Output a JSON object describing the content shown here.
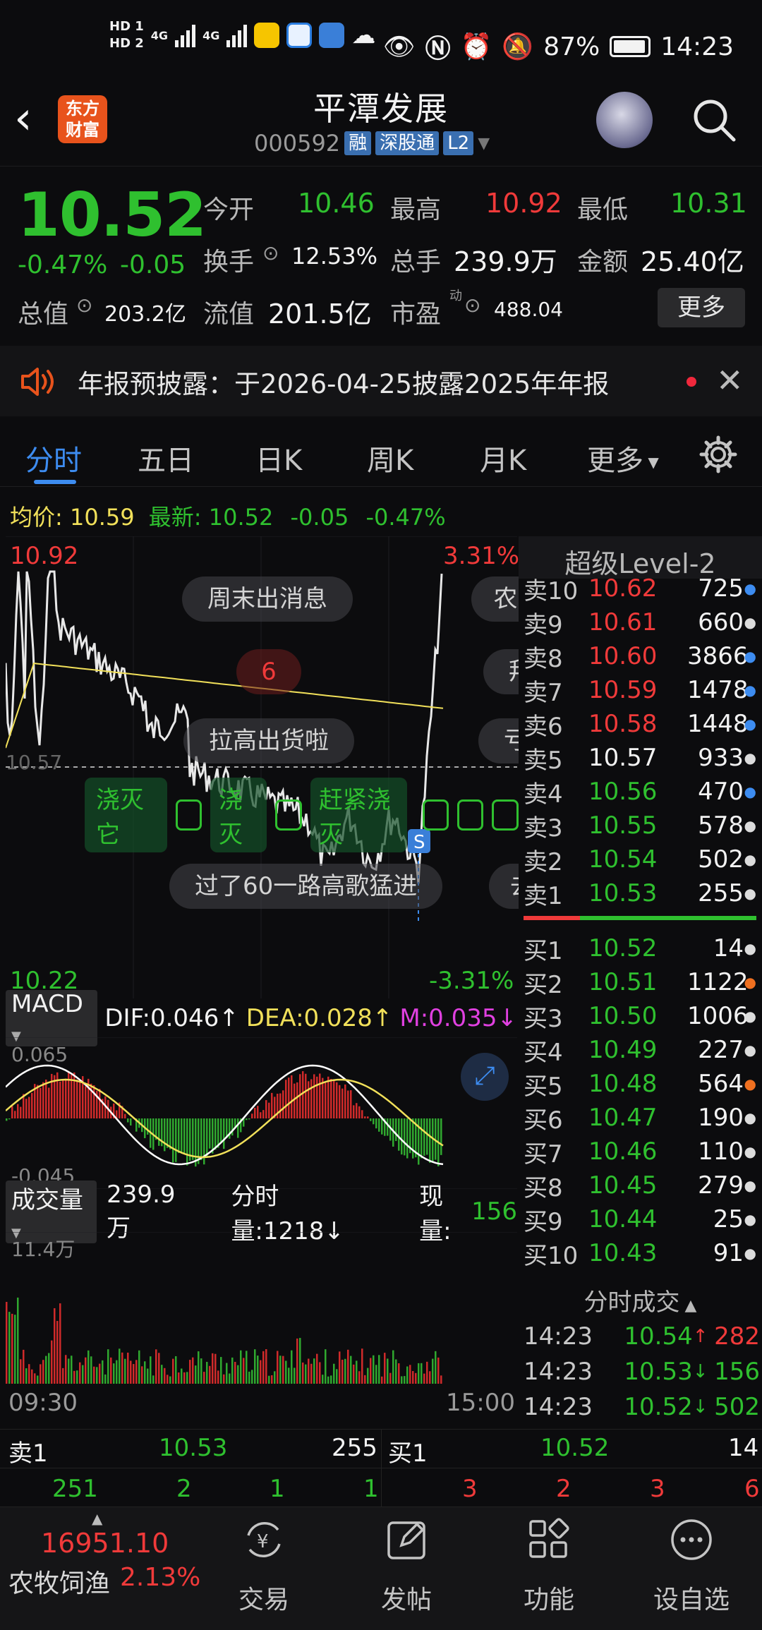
{
  "status_bar": {
    "left_badges": [
      "HD 1",
      "HD 2"
    ],
    "net1": "4G",
    "net2": "4G",
    "battery": "87%",
    "time": "14:23"
  },
  "header": {
    "title": "平潭发展",
    "code": "000592",
    "tags": [
      "融",
      "深股通",
      "L2"
    ],
    "logo_text": "东方\n财富"
  },
  "quote": {
    "price": "10.52",
    "change_pct": "-0.47%",
    "change": "-0.05",
    "open_label": "今开",
    "open": "10.46",
    "high_label": "最高",
    "high": "10.92",
    "low_label": "最低",
    "low": "10.31",
    "turnover_label": "换手",
    "turnover": "12.53%",
    "volume_label": "总手",
    "volume": "239.9万",
    "amount_label": "金额",
    "amount": "25.40亿",
    "mcap_label": "总值",
    "mcap": "203.2亿",
    "float_label": "流值",
    "float": "201.5亿",
    "pe_label": "市盈",
    "pe_sup": "动",
    "pe": "488.04",
    "more": "更多"
  },
  "notice": {
    "text": "年报预披露：于2026-04-25披露2025年年报"
  },
  "tabs": [
    "分时",
    "五日",
    "日K",
    "周K",
    "月K",
    "更多"
  ],
  "avg": {
    "avg_label": "均价:",
    "avg": "10.59",
    "last_label": "最新:",
    "last": "10.52",
    "chg": "-0.05",
    "pct": "-0.47%"
  },
  "chart_labels": {
    "high": "10.92",
    "low": "10.22",
    "up_pct": "3.31%",
    "down_pct": "-3.31%",
    "start": "09:30",
    "end": "15:00",
    "s_mark": "S",
    "num": "6",
    "ref_price": "10.57"
  },
  "danmaku": [
    "周末出消息",
    "拉高出货啦",
    "浇灭它",
    "浇灭",
    "赶紧浇灭",
    "过了60一路高歌猛进",
    "农",
    "拜",
    "亏",
    "去"
  ],
  "level2": {
    "title": "超级Level-2",
    "asks": [
      {
        "label": "卖10",
        "price": "10.62",
        "vol": "725"
      },
      {
        "label": "卖9",
        "price": "10.61",
        "vol": "660"
      },
      {
        "label": "卖8",
        "price": "10.60",
        "vol": "3866"
      },
      {
        "label": "卖7",
        "price": "10.59",
        "vol": "1478"
      },
      {
        "label": "卖6",
        "price": "10.58",
        "vol": "1448"
      },
      {
        "label": "卖5",
        "price": "10.57",
        "vol": "933"
      },
      {
        "label": "卖4",
        "price": "10.56",
        "vol": "470"
      },
      {
        "label": "卖3",
        "price": "10.55",
        "vol": "578"
      },
      {
        "label": "卖2",
        "price": "10.54",
        "vol": "502"
      },
      {
        "label": "卖1",
        "price": "10.53",
        "vol": "255"
      }
    ],
    "bids": [
      {
        "label": "买1",
        "price": "10.52",
        "vol": "14"
      },
      {
        "label": "买2",
        "price": "10.51",
        "vol": "1122"
      },
      {
        "label": "买3",
        "price": "10.50",
        "vol": "1006"
      },
      {
        "label": "买4",
        "price": "10.49",
        "vol": "227"
      },
      {
        "label": "买5",
        "price": "10.48",
        "vol": "564"
      },
      {
        "label": "买6",
        "price": "10.47",
        "vol": "190"
      },
      {
        "label": "买7",
        "price": "10.46",
        "vol": "110"
      },
      {
        "label": "买8",
        "price": "10.45",
        "vol": "279"
      },
      {
        "label": "买9",
        "price": "10.44",
        "vol": "25"
      },
      {
        "label": "买10",
        "price": "10.43",
        "vol": "91"
      }
    ]
  },
  "macd": {
    "name": "MACD",
    "dif": "DIF:0.046↑",
    "dea": "DEA:0.028↑",
    "m": "M:0.035↓",
    "top": "0.065",
    "bottom": "-0.045"
  },
  "volume_panel": {
    "name": "成交量",
    "total": "239.9万",
    "fenshi": "分时量:1218↓",
    "now_label": "现量:",
    "now": "156",
    "max": "11.4万"
  },
  "trades": {
    "title": "分时成交",
    "rows": [
      {
        "time": "14:23",
        "price": "10.54",
        "arrow": "↑",
        "vol": "282"
      },
      {
        "time": "14:23",
        "price": "10.53",
        "arrow": "↓",
        "vol": "156"
      },
      {
        "time": "14:23",
        "price": "10.52",
        "arrow": "↓",
        "vol": "502"
      }
    ]
  },
  "bottom_quote": {
    "sell_label": "卖1",
    "sell_price": "10.53",
    "sell_vol": "255",
    "buy_label": "买1",
    "buy_price": "10.52",
    "buy_vol": "14",
    "sell_detail": [
      "251",
      "2",
      "1",
      "1"
    ],
    "buy_detail": [
      "3",
      "2",
      "3",
      "6"
    ]
  },
  "nav": {
    "index_value": "16951.10",
    "index_name": "农牧饲渔",
    "index_pct": "2.13%",
    "items": [
      "交易",
      "发帖",
      "功能",
      "设自选"
    ]
  },
  "colors": {
    "up": "#f03a3a",
    "down": "#2fc02f",
    "accent": "#3d8cf0",
    "avg": "#f1e05a",
    "bg": "#0c0c0e"
  }
}
